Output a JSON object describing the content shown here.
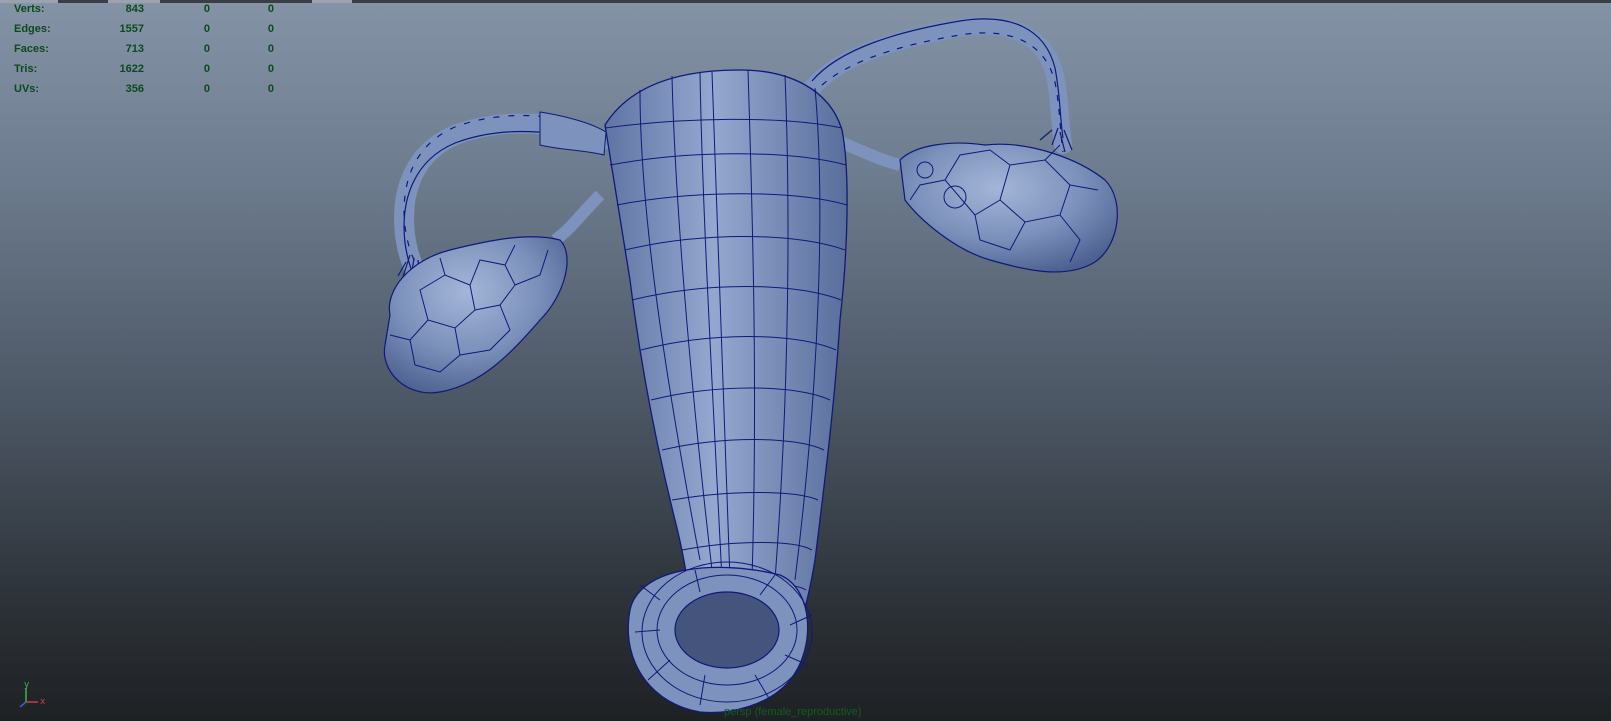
{
  "hud": {
    "rows": [
      {
        "label": "Verts:",
        "values": [
          "843",
          "0",
          "0"
        ]
      },
      {
        "label": "Edges:",
        "values": [
          "1557",
          "0",
          "0"
        ]
      },
      {
        "label": "Faces:",
        "values": [
          "713",
          "0",
          "0"
        ]
      },
      {
        "label": "Tris:",
        "values": [
          "1622",
          "0",
          "0"
        ]
      },
      {
        "label": "UVs:",
        "values": [
          "356",
          "0",
          "0"
        ]
      }
    ]
  },
  "camera_label": "persp (female_reproductive)",
  "axis": {
    "x": "x",
    "y": "y",
    "z": "z"
  },
  "colors": {
    "mesh_fill": "#7d93bd",
    "wireframe": "#10197a",
    "hud_text": "#0b4a1c"
  }
}
